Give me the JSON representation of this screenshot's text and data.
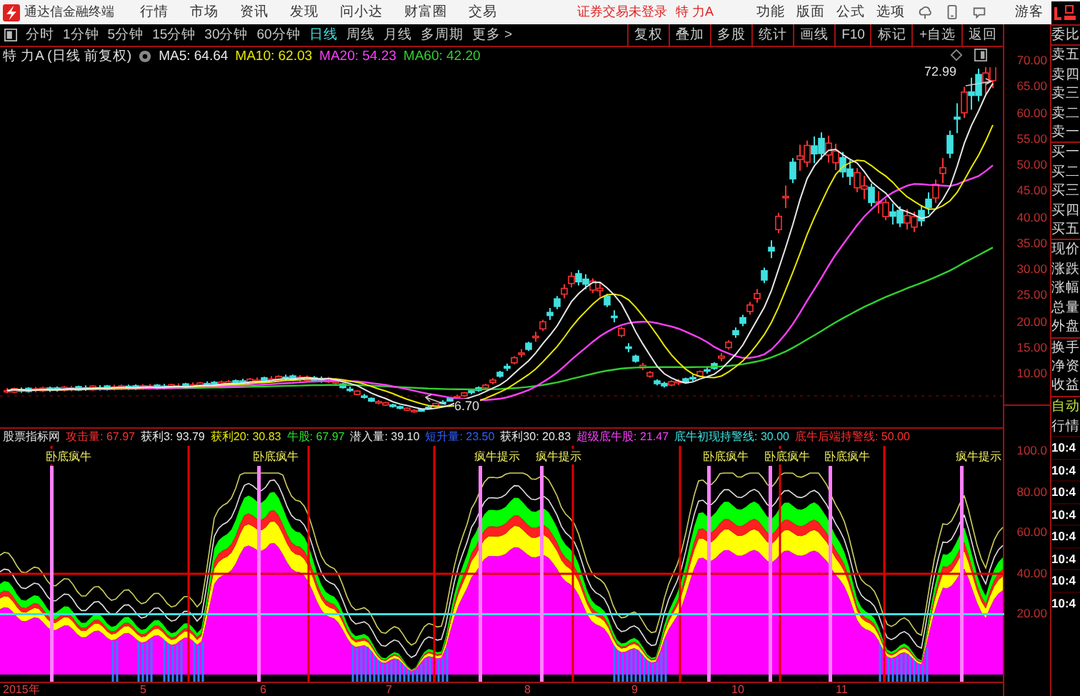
{
  "title_bar": {
    "app_name": "通达信金融终端",
    "menu": [
      "行情",
      "市场",
      "资讯",
      "发现",
      "问小达",
      "财富圈",
      "交易"
    ],
    "login_status": "证券交易未登录",
    "stock": "特 力A",
    "right_menu": [
      "功能",
      "版面",
      "公式",
      "选项"
    ],
    "user": "游客"
  },
  "period_tabs": [
    {
      "label": "分时",
      "selected": false
    },
    {
      "label": "1分钟",
      "selected": false
    },
    {
      "label": "5分钟",
      "selected": false
    },
    {
      "label": "15分钟",
      "selected": false
    },
    {
      "label": "30分钟",
      "selected": false
    },
    {
      "label": "60分钟",
      "selected": false
    },
    {
      "label": "日线",
      "selected": true
    },
    {
      "label": "周线",
      "selected": false
    },
    {
      "label": "月线",
      "selected": false
    },
    {
      "label": "多周期",
      "selected": false
    },
    {
      "label": "更多 >",
      "selected": false
    }
  ],
  "tools": [
    "复权",
    "叠加",
    "多股",
    "统计",
    "画线",
    "F10",
    "标记",
    "+自选",
    "返回"
  ],
  "legend": {
    "title": "特 力A (日线 前复权)",
    "ma": [
      {
        "label": "MA5: 64.64",
        "color": "#e8e8e8"
      },
      {
        "label": "MA10: 62.03",
        "color": "#e8e800"
      },
      {
        "label": "MA20: 54.23",
        "color": "#ff40ff"
      },
      {
        "label": "MA60: 42.20",
        "color": "#30d030"
      }
    ]
  },
  "price_axis": [
    "70.00",
    "65.00",
    "60.00",
    "55.00",
    "50.00",
    "45.00",
    "40.00",
    "35.00",
    "30.00",
    "25.00",
    "20.00",
    "15.00",
    "10.00"
  ],
  "price_marks": {
    "high": "72.99",
    "low": "6.70"
  },
  "indicator": {
    "name": "股票指标网",
    "values": [
      {
        "label": "攻击量: 67.97",
        "color": "#ff3030"
      },
      {
        "label": "获利3: 93.79",
        "color": "#e8e8e8"
      },
      {
        "label": "获利20: 30.83",
        "color": "#e8e800"
      },
      {
        "label": "牛股: 67.97",
        "color": "#30e030"
      },
      {
        "label": "潜入量: 39.10",
        "color": "#e8e8e8"
      },
      {
        "label": "短升量: 23.50",
        "color": "#3060ff"
      },
      {
        "label": "获利30: 20.83",
        "color": "#e8e8e8"
      },
      {
        "label": "超级底牛股: 21.47",
        "color": "#ff40ff"
      },
      {
        "label": "底牛初现持警线: 30.00",
        "color": "#40e0e0"
      },
      {
        "label": "底牛后端持警线: 50.00",
        "color": "#ff3030"
      }
    ],
    "axis": [
      "100.0",
      "80.00",
      "60.00",
      "40.00",
      "20.00"
    ],
    "signals": [
      "卧底疯牛",
      "卧底疯牛",
      "疯牛提示",
      "疯牛提示",
      "卧底疯牛",
      "卧底疯牛",
      "卧底疯牛",
      "疯牛提示"
    ]
  },
  "x_axis": [
    "2015年",
    "5",
    "6",
    "7",
    "8",
    "9",
    "10",
    "11"
  ],
  "quote_panel": {
    "groups": [
      [
        "委比"
      ],
      [
        "卖五",
        "卖四",
        "卖三",
        "卖二",
        "卖一"
      ],
      [
        "买一",
        "买二",
        "买三",
        "买四",
        "买五"
      ],
      [
        "现价",
        "涨跌",
        "涨幅",
        "总量",
        "外盘"
      ],
      [
        "换手",
        "净资",
        "收益"
      ]
    ],
    "mode": "自动",
    "tab": "行情",
    "times": [
      "10:4",
      "10:4",
      "10:4",
      "10:4",
      "10:4",
      "10:4",
      "10:4",
      "10:4"
    ]
  }
}
